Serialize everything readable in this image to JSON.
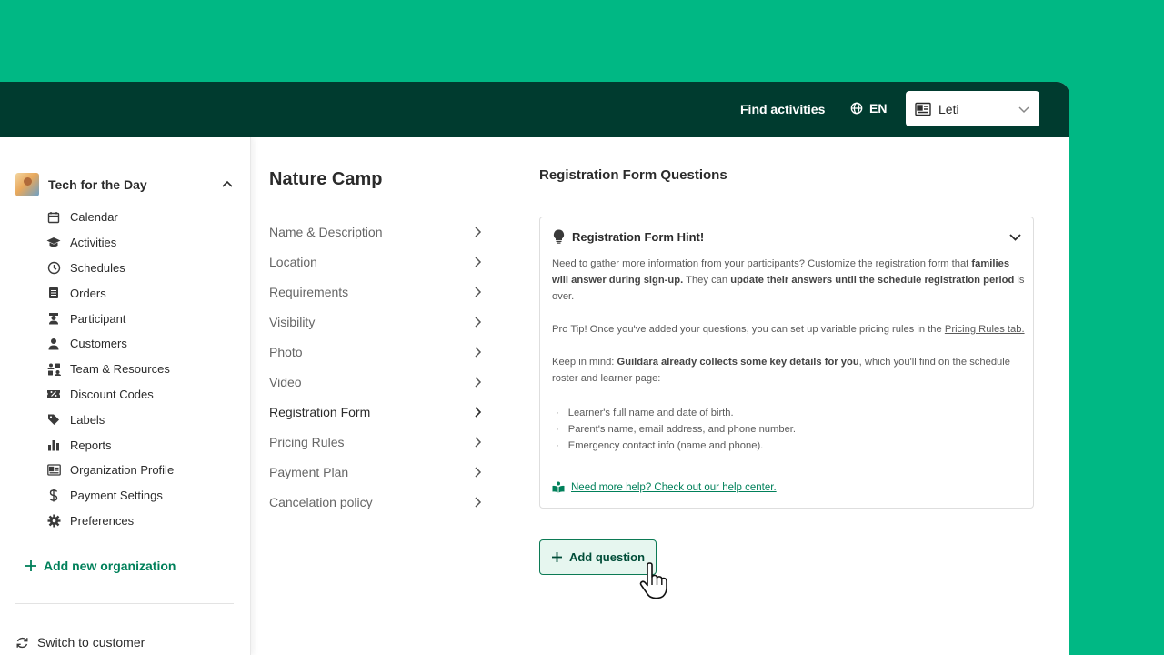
{
  "header": {
    "find_activities": "Find activities",
    "language": "EN",
    "account_name": "Leti"
  },
  "sidebar": {
    "org_name": "Tech for the Day",
    "items": [
      {
        "label": "Calendar",
        "icon": "calendar-icon"
      },
      {
        "label": "Activities",
        "icon": "graduation-cap-icon"
      },
      {
        "label": "Schedules",
        "icon": "clock-icon"
      },
      {
        "label": "Orders",
        "icon": "receipt-icon"
      },
      {
        "label": "Participant",
        "icon": "student-icon"
      },
      {
        "label": "Customers",
        "icon": "person-icon"
      },
      {
        "label": "Team & Resources",
        "icon": "team-icon"
      },
      {
        "label": "Discount Codes",
        "icon": "discount-icon"
      },
      {
        "label": "Labels",
        "icon": "tag-icon"
      },
      {
        "label": "Reports",
        "icon": "bar-chart-icon"
      },
      {
        "label": "Organization Profile",
        "icon": "id-card-icon"
      },
      {
        "label": "Payment Settings",
        "icon": "dollar-icon"
      },
      {
        "label": "Preferences",
        "icon": "gear-icon"
      }
    ],
    "add_org": "Add new organization",
    "switch_customer": "Switch to customer"
  },
  "settings": {
    "title": "Nature Camp",
    "menu": [
      {
        "label": "Name & Description",
        "active": false
      },
      {
        "label": "Location",
        "active": false
      },
      {
        "label": "Requirements",
        "active": false
      },
      {
        "label": "Visibility",
        "active": false
      },
      {
        "label": "Photo",
        "active": false
      },
      {
        "label": "Video",
        "active": false
      },
      {
        "label": "Registration Form",
        "active": true
      },
      {
        "label": "Pricing Rules",
        "active": false
      },
      {
        "label": "Payment Plan",
        "active": false
      },
      {
        "label": "Cancelation policy",
        "active": false
      }
    ]
  },
  "main": {
    "section_title": "Registration Form Questions",
    "hint": {
      "title": "Registration Form Hint!",
      "p1_a": "Need to gather more information from your participants?  Customize the registration form that ",
      "p1_b": "families will answer during sign-up.",
      "p1_c": " They can ",
      "p1_d": "update their answers until the schedule registration period",
      "p1_e": " is over.",
      "p2_a": "Pro Tip! Once you've added your questions, you can set up variable pricing rules in the ",
      "p2_link": "Pricing Rules tab.",
      "p3_a": "Keep in mind: ",
      "p3_b": "Guildara already collects some key details for you",
      "p3_c": ", which you'll find on the schedule roster and learner page:",
      "bullets": [
        "Learner's full name and date of birth.",
        "Parent's name, email address, and phone number.",
        "Emergency contact info (name and phone)."
      ],
      "help_link": "Need more help? Check out our help center."
    },
    "add_question": "Add question"
  },
  "colors": {
    "brand_green": "#00b884",
    "topbar": "#003b2f",
    "accent": "#00805a"
  }
}
